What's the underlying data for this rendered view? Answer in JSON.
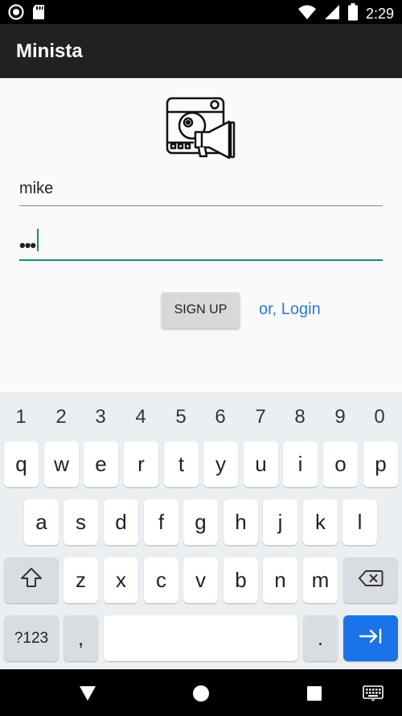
{
  "status_bar": {
    "time": "2:29"
  },
  "app_bar": {
    "title": "Minista"
  },
  "form": {
    "username_value": "mike",
    "password_mask": "•••",
    "signup_label": "SIGN UP",
    "login_link": "or, Login"
  },
  "keyboard": {
    "number_row": [
      "1",
      "2",
      "3",
      "4",
      "5",
      "6",
      "7",
      "8",
      "9",
      "0"
    ],
    "row1": [
      "q",
      "w",
      "e",
      "r",
      "t",
      "y",
      "u",
      "i",
      "o",
      "p"
    ],
    "row2": [
      "a",
      "s",
      "d",
      "f",
      "g",
      "h",
      "j",
      "k",
      "l"
    ],
    "row3": [
      "z",
      "x",
      "c",
      "v",
      "b",
      "n",
      "m"
    ],
    "symbols_label": "?123",
    "comma": ",",
    "period": "."
  },
  "colors": {
    "accent": "#148a7e",
    "link": "#2a7bd6",
    "appbar": "#212121",
    "enter_key": "#1a73e8"
  },
  "icons": [
    "record-icon",
    "sd-card-icon",
    "wifi-icon",
    "signal-icon",
    "battery-icon",
    "app-logo-icon",
    "shift-icon",
    "backspace-icon",
    "enter-icon",
    "nav-back-icon",
    "nav-home-icon",
    "nav-recents-icon",
    "keyboard-icon"
  ]
}
